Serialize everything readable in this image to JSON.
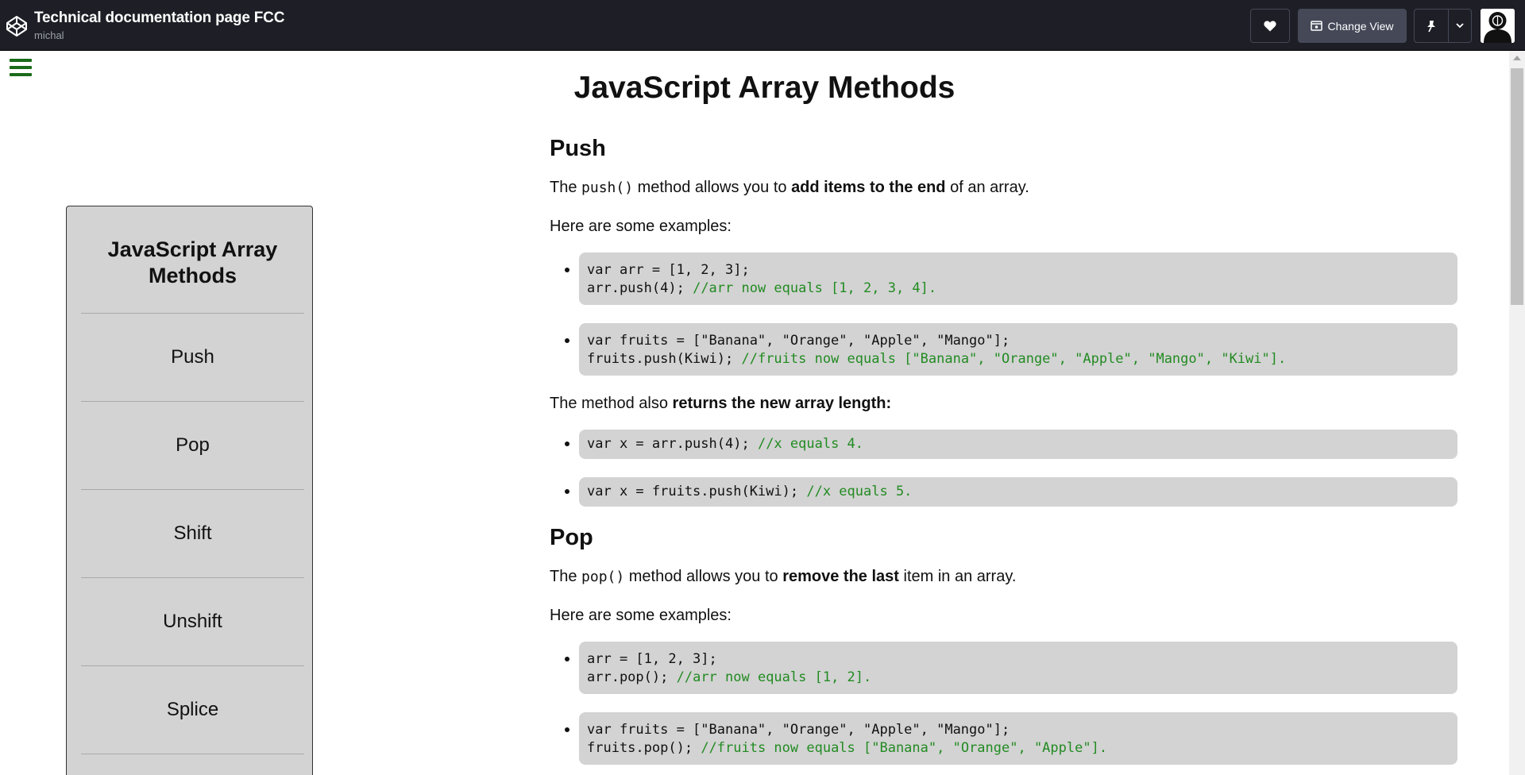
{
  "header": {
    "title": "Technical documentation page FCC",
    "author": "michal",
    "change_view_label": "Change View"
  },
  "nav": {
    "title": "JavaScript Array Methods",
    "items": [
      "Push",
      "Pop",
      "Shift",
      "Unshift",
      "Splice"
    ]
  },
  "main": {
    "title": "JavaScript Array Methods",
    "push": {
      "heading": "Push",
      "intro_pre": "The ",
      "intro_code": "push()",
      "intro_mid": " method allows you to ",
      "intro_bold": "add items to the end",
      "intro_post": " of an array.",
      "examples_label": "Here are some examples:",
      "ex1_line1": "var arr = [1, 2, 3];",
      "ex1_line2_code": "arr.push(4);",
      "ex1_line2_comment": "//arr now equals [1, 2, 3, 4].",
      "ex2_line1": "var fruits = [\"Banana\", \"Orange\", \"Apple\", \"Mango\"];",
      "ex2_line2_code": "fruits.push(Kiwi);",
      "ex2_line2_comment": "//fruits now equals [\"Banana\", \"Orange\", \"Apple\", \"Mango\", \"Kiwi\"].",
      "returns_pre": "The method also ",
      "returns_bold": "returns the new array length:",
      "ret1_code": "var x = arr.push(4);",
      "ret1_comment": "//x equals 4.",
      "ret2_code": "var x = fruits.push(Kiwi);",
      "ret2_comment": "//x equals 5."
    },
    "pop": {
      "heading": "Pop",
      "intro_pre": "The ",
      "intro_code": "pop()",
      "intro_mid": " method allows you to ",
      "intro_bold": "remove the last",
      "intro_post": " item in an array.",
      "examples_label": "Here are some examples:",
      "ex1_line1": "arr = [1, 2, 3];",
      "ex1_line2_code": "arr.pop();",
      "ex1_line2_comment": "//arr now equals [1, 2].",
      "ex2_line1": "var fruits = [\"Banana\", \"Orange\", \"Apple\", \"Mango\"];",
      "ex2_line2_code": "fruits.pop();",
      "ex2_line2_comment": "//fruits now equals [\"Banana\", \"Orange\", \"Apple\"]."
    }
  },
  "colors": {
    "header_bg": "#1e1f26",
    "code_bg": "#d3d3d3",
    "comment": "#228b22",
    "hamburger": "#1a6b1a"
  }
}
